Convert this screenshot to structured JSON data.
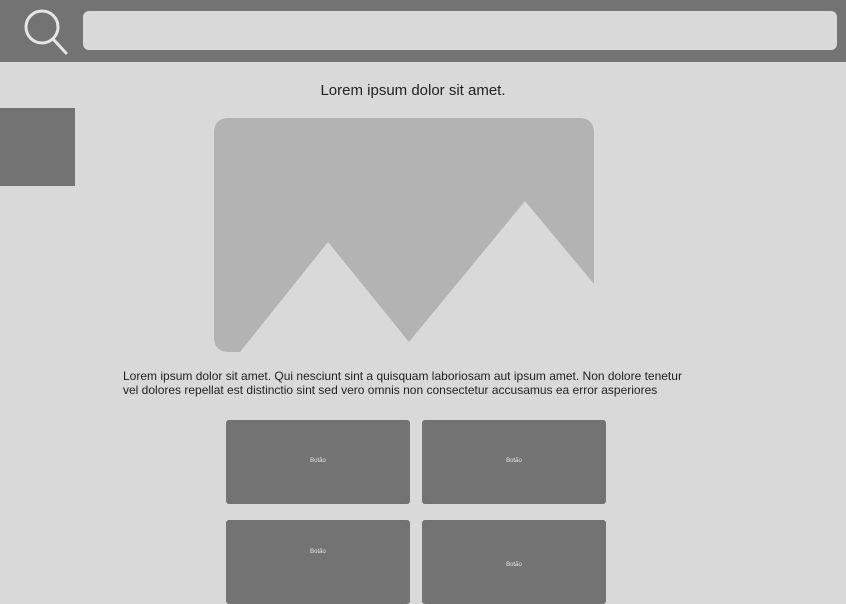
{
  "header": {
    "search_icon": "search-icon",
    "search_value": ""
  },
  "main": {
    "title": "Lorem ipsum dolor sit amet.",
    "image_icon": "image-placeholder-icon",
    "body_line_1": "Lorem ipsum dolor sit amet. Qui nesciunt sint a quisquam laboriosam aut ipsum amet. Non dolore tenetur",
    "body_line_2": "vel dolores repellat est distinctio sint sed vero omnis non consectetur accusamus ea error asperiores"
  },
  "buttons": [
    {
      "label": "Botão"
    },
    {
      "label": "Botão"
    },
    {
      "label": "Botão"
    },
    {
      "label": "Botão"
    }
  ],
  "colors": {
    "background": "#d9d9d9",
    "dark_block": "#737373",
    "image_fill": "#b3b3b3"
  }
}
